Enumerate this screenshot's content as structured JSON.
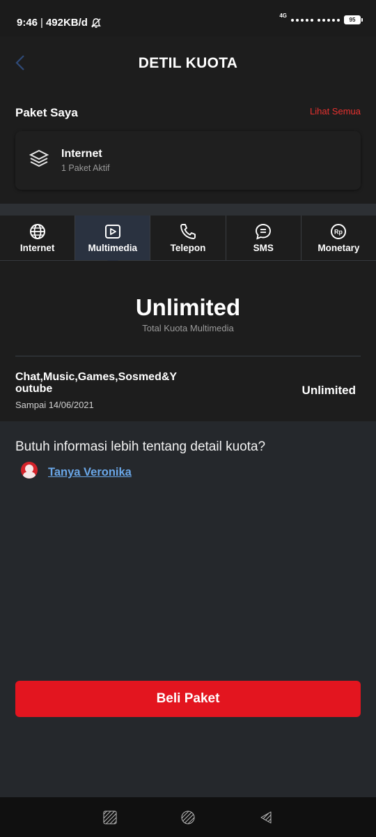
{
  "status_bar": {
    "time": "9:46",
    "speed": "492KB/d",
    "network": "4G",
    "battery": "95"
  },
  "header": {
    "title": "DETIL KUOTA",
    "back_icon": "chevron-left-icon"
  },
  "paket_saya": {
    "title": "Paket Saya",
    "see_all": "Lihat Semua",
    "card": {
      "icon": "layers-icon",
      "name": "Internet",
      "subtitle": "1 Paket Aktif"
    }
  },
  "tabs": [
    {
      "label": "Internet",
      "icon": "globe-icon",
      "active": false
    },
    {
      "label": "Multimedia",
      "icon": "play-icon",
      "active": true
    },
    {
      "label": "Telepon",
      "icon": "phone-icon",
      "active": false
    },
    {
      "label": "SMS",
      "icon": "chat-icon",
      "active": false
    },
    {
      "label": "Monetary",
      "icon": "rp-coin-icon",
      "active": false
    }
  ],
  "quota": {
    "total": "Unlimited",
    "total_label": "Total Kuota Multimedia",
    "item": {
      "name_line1": "Chat,Music,Games,Sosmed&Y",
      "name_line2": "outube",
      "expiry": "Sampai 14/06/2021",
      "value": "Unlimited"
    }
  },
  "info": {
    "question": "Butuh informasi lebih tentang detail kuota?",
    "link": "Tanya Veronika"
  },
  "buy_button": "Beli Paket",
  "colors": {
    "accent_red": "#e3151f",
    "link_blue": "#6aa7e8",
    "active_tab": "#2a3240"
  }
}
